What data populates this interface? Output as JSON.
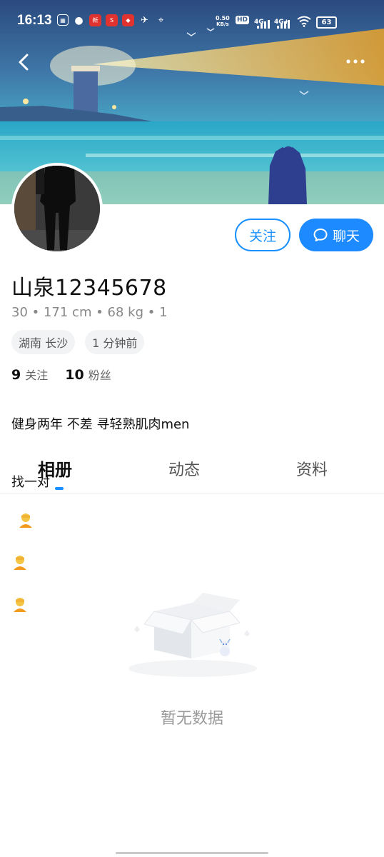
{
  "status_bar": {
    "time": "16:13",
    "net_speed_value": "0.50",
    "net_speed_unit": "KB/s",
    "hd_label": "HD",
    "signal1": "4G",
    "signal2": "4G+",
    "battery": "63"
  },
  "profile": {
    "username": "山泉12345678",
    "stats": "30 • 171 cm • 68 kg • 1",
    "tags": [
      "湖南 长沙",
      "1 分钟前"
    ],
    "following_count": "9",
    "following_label": "关注",
    "followers_count": "10",
    "followers_label": "粉丝",
    "bio_line1": "健身两年  不差 寻轻熟肌肉men",
    "bio_line2": "找一对"
  },
  "actions": {
    "follow_label": "关注",
    "chat_label": "聊天"
  },
  "tabs": [
    {
      "label": "相册",
      "active": true
    },
    {
      "label": "动态",
      "active": false
    },
    {
      "label": "资料",
      "active": false
    }
  ],
  "empty_state": {
    "text": "暂无数据"
  },
  "colors": {
    "accent": "#1890ff",
    "tag_bg": "#f2f3f5"
  }
}
